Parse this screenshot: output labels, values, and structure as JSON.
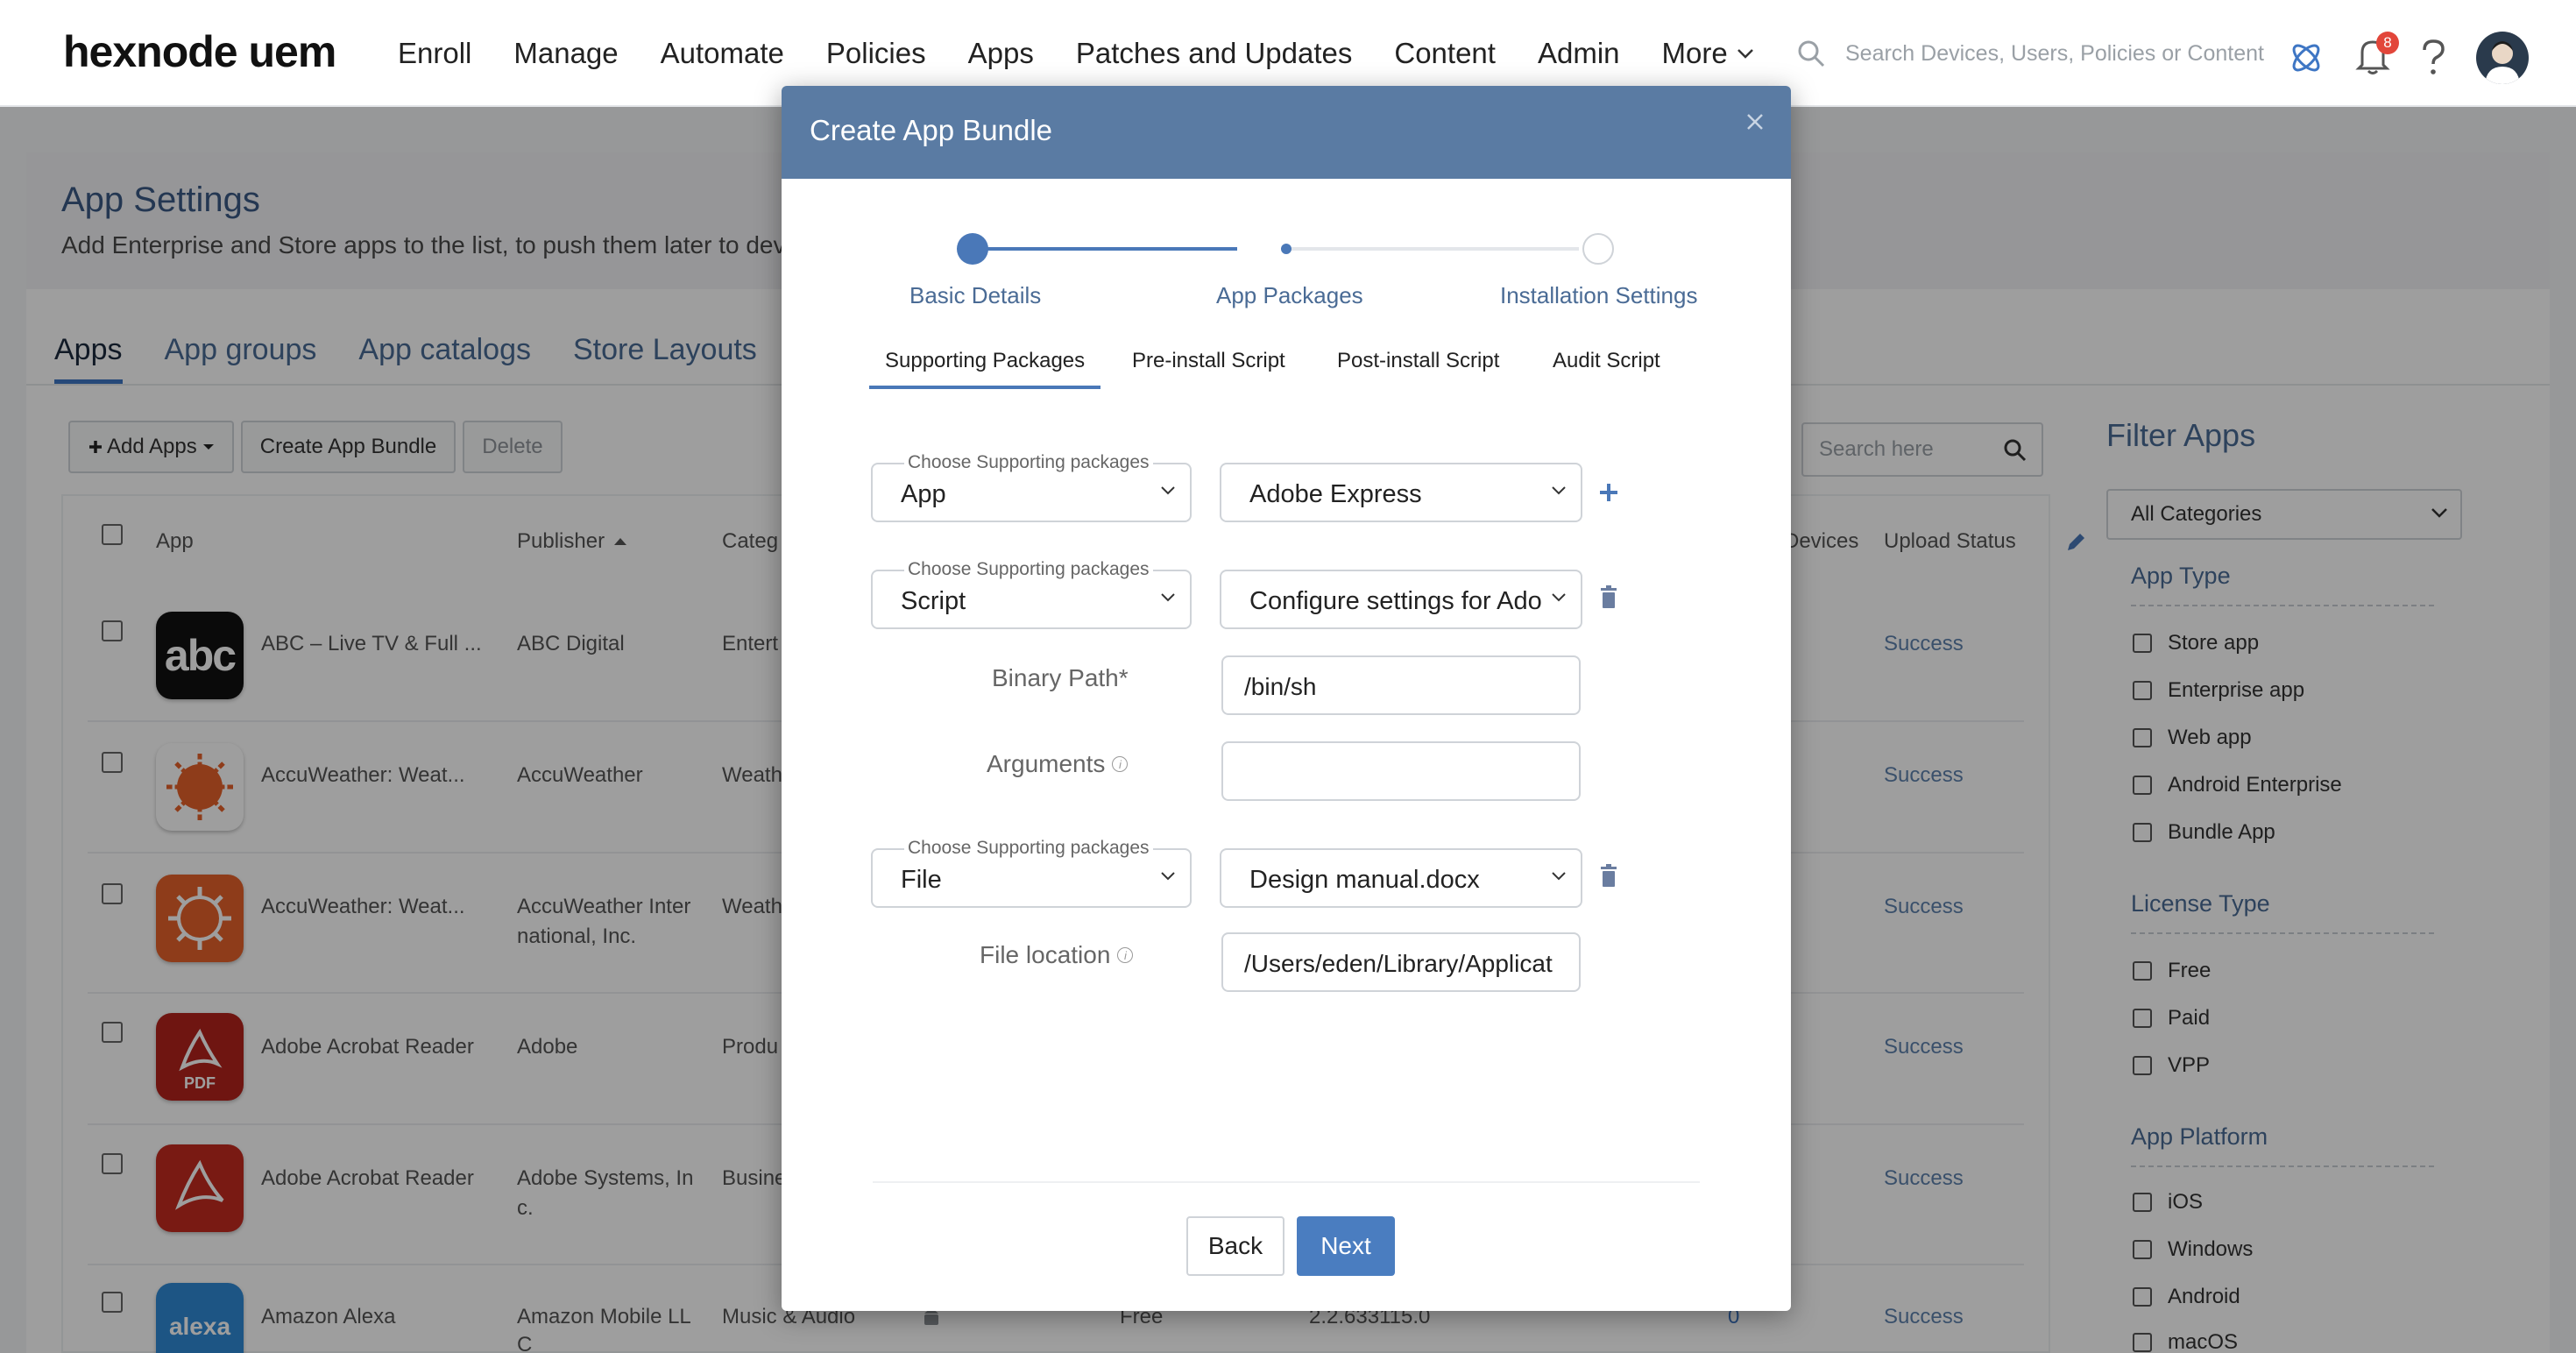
{
  "topbar": {
    "logo": "hexnode uem",
    "nav": [
      "Enroll",
      "Manage",
      "Automate",
      "Policies",
      "Apps",
      "Patches and Updates",
      "Content",
      "Admin"
    ],
    "more": "More",
    "search_placeholder": "Search Devices, Users, Policies or Content",
    "notification_count": "8"
  },
  "page": {
    "title": "App Settings",
    "subtitle": "Add Enterprise and Store apps to the list, to push them later to devic",
    "tabs": [
      "Apps",
      "App groups",
      "App catalogs",
      "Store Layouts"
    ],
    "active_tab": "Apps",
    "toolbar": {
      "add_apps": "Add Apps",
      "create_bundle": "Create App Bundle",
      "delete": "Delete"
    },
    "search_placeholder": "Search here"
  },
  "table": {
    "headers": {
      "app": "App",
      "publisher": "Publisher",
      "category": "Categ",
      "devices": "Devices",
      "upload_status": "Upload Status"
    },
    "rows": [
      {
        "app": "ABC – Live TV & Full ...",
        "publisher": "ABC Digital",
        "publisher2": "",
        "category": "Entert",
        "status": "Success",
        "icon": "abc-icon"
      },
      {
        "app": "AccuWeather: Weat...",
        "publisher": "AccuWeather",
        "publisher2": "",
        "category": "Weath",
        "status": "Success",
        "icon": "accuweather-icon"
      },
      {
        "app": "AccuWeather: Weat...",
        "publisher": "AccuWeather Inter",
        "publisher2": "national, Inc.",
        "category": "Weath",
        "status": "Success",
        "icon": "accuweather-icon"
      },
      {
        "app": "Adobe Acrobat Reader",
        "publisher": "Adobe",
        "publisher2": "",
        "category": "Produ",
        "status": "Success",
        "icon": "acrobat-pdf-icon"
      },
      {
        "app": "Adobe Acrobat Reader",
        "publisher": "Adobe Systems, In",
        "publisher2": "c.",
        "category": "Busine",
        "status": "Success",
        "icon": "acrobat-icon"
      },
      {
        "app": "Amazon Alexa",
        "publisher": "Amazon Mobile LL",
        "publisher2": "C",
        "category": "Music & Audio",
        "price": "Free",
        "version": "2.2.633115.0",
        "devices": "0",
        "status": "Success",
        "icon": "alexa-icon",
        "icon_text": "alexa"
      }
    ]
  },
  "filter": {
    "title": "Filter Apps",
    "category_select": "All Categories",
    "groups": [
      {
        "label": "App Type",
        "options": [
          "Store app",
          "Enterprise app",
          "Web app",
          "Android Enterprise",
          "Bundle App"
        ]
      },
      {
        "label": "License Type",
        "options": [
          "Free",
          "Paid",
          "VPP"
        ]
      },
      {
        "label": "App Platform",
        "options": [
          "iOS",
          "Windows",
          "Android",
          "macOS"
        ]
      }
    ]
  },
  "modal": {
    "title": "Create App Bundle",
    "steps": [
      "Basic Details",
      "App Packages",
      "Installation Settings"
    ],
    "current_step": 2,
    "subtabs": [
      "Supporting Packages",
      "Pre-install Script",
      "Post-install Script",
      "Audit Script"
    ],
    "active_subtab": "Supporting Packages",
    "legend": "Choose Supporting packages",
    "rows": [
      {
        "type": "App",
        "value": "Adobe Express",
        "action": "add"
      },
      {
        "type": "Script",
        "value": "Configure settings for Ado",
        "action": "delete"
      },
      {
        "type": "File",
        "value": "Design manual.docx",
        "action": "delete"
      }
    ],
    "binary_path_label": "Binary Path*",
    "binary_path_value": "/bin/sh",
    "arguments_label": "Arguments",
    "arguments_value": "",
    "file_location_label": "File location",
    "file_location_value": "/Users/eden/Library/Applicat",
    "back": "Back",
    "next": "Next"
  },
  "colors": {
    "accent": "#4a7dc0",
    "modal_header": "#5a7ba3",
    "status": "#5e82ad"
  }
}
